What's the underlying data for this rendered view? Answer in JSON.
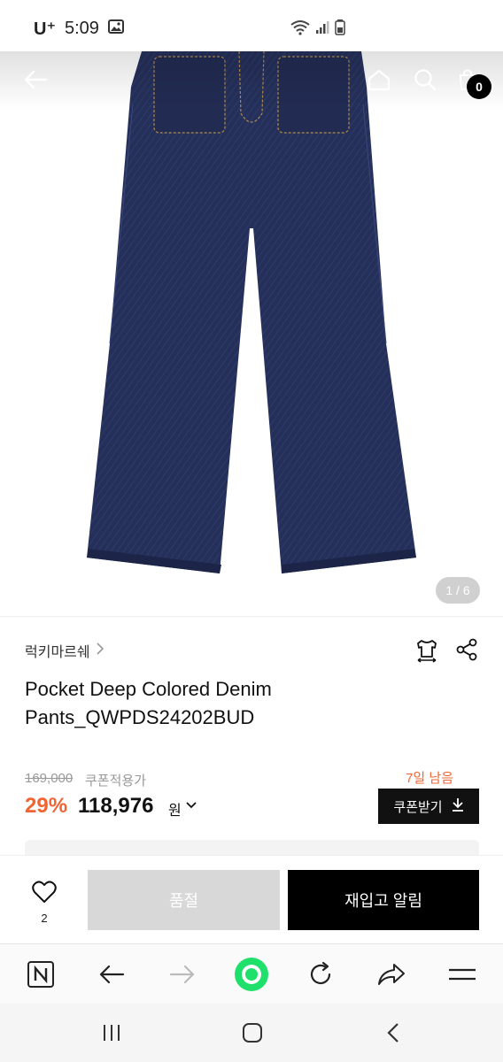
{
  "status_bar": {
    "carrier": "U⁺",
    "time": "5:09"
  },
  "header": {
    "cart_count": "0"
  },
  "gallery": {
    "counter": "1 / 6"
  },
  "product": {
    "brand": "럭키마르쉐",
    "name": "Pocket Deep Colored Denim Pants_QWPDS24202BUD",
    "original_price": "169,000",
    "coupon_price_label": "쿠폰적용가",
    "discount_rate": "29%",
    "sale_price": "118,976",
    "currency": "원",
    "days_left": "7일 남음",
    "coupon_button": "쿠폰받기"
  },
  "actions": {
    "like_count": "2",
    "soldout_label": "품절",
    "restock_label": "재입고 알림"
  },
  "colors": {
    "accent": "#f06432",
    "denim": "#25305a",
    "black": "#000000"
  }
}
